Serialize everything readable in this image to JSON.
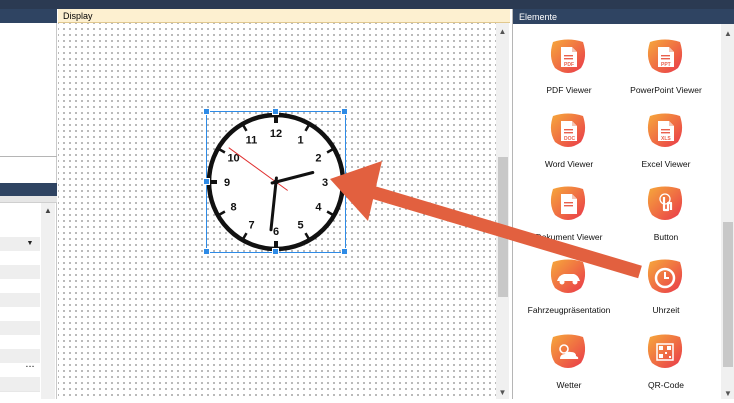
{
  "display": {
    "title": "Display"
  },
  "elements": {
    "title": "Elemente",
    "items": [
      {
        "label": "PDF Viewer",
        "icon": "pdf-document-icon",
        "badge": "PDF"
      },
      {
        "label": "PowerPoint Viewer",
        "icon": "pptx-document-icon",
        "badge": "PPT"
      },
      {
        "label": "Word Viewer",
        "icon": "doc-document-icon",
        "badge": "DOC"
      },
      {
        "label": "Excel Viewer",
        "icon": "xls-document-icon",
        "badge": "XLS"
      },
      {
        "label": "Dokument Viewer",
        "icon": "document-icon",
        "badge": ""
      },
      {
        "label": "Button",
        "icon": "tap-hand-icon",
        "badge": ""
      },
      {
        "label": "Fahrzeugpräsentation",
        "icon": "car-icon",
        "badge": ""
      },
      {
        "label": "Uhrzeit",
        "icon": "clock-icon",
        "badge": ""
      },
      {
        "label": "Wetter",
        "icon": "weather-icon",
        "badge": ""
      },
      {
        "label": "QR-Code",
        "icon": "qr-code-icon",
        "badge": ""
      }
    ]
  },
  "clock": {
    "numbers": [
      "12",
      "1",
      "2",
      "3",
      "4",
      "5",
      "6",
      "7",
      "8",
      "9",
      "10",
      "11"
    ],
    "hour": 2,
    "minute": 31,
    "second": 51
  },
  "left_panel": {
    "ellipsis_label": "..."
  },
  "colors": {
    "accent_gradient_start": "#f6a93b",
    "accent_gradient_end": "#e9384a",
    "annotation_arrow": "#e2603f",
    "selection": "#2e8be6",
    "header_dark": "#2f4462",
    "display_header": "#fdf0d0"
  }
}
